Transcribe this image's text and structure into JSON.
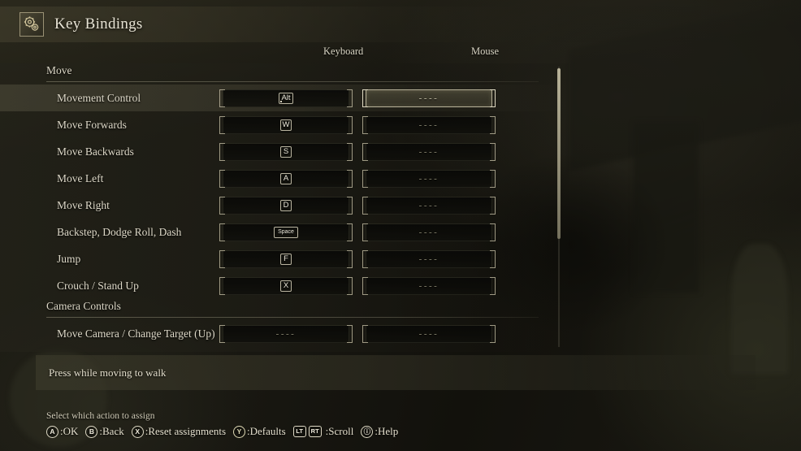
{
  "titlebar": {
    "icon": "gears-icon",
    "title": "Key Bindings"
  },
  "columns": {
    "keyboard": "Keyboard",
    "mouse": "Mouse"
  },
  "sections": [
    {
      "label": "Move",
      "rows": [
        {
          "label": "Movement Control",
          "keyboard": "Alt",
          "keyboard_type": "keycap",
          "keyboard_dotted": true,
          "mouse": "----",
          "selected": true,
          "selected_col": "mouse"
        },
        {
          "label": "Move Forwards",
          "keyboard": "W",
          "keyboard_type": "keycap",
          "keyboard_dotted": false,
          "mouse": "----",
          "selected": false,
          "selected_col": ""
        },
        {
          "label": "Move Backwards",
          "keyboard": "S",
          "keyboard_type": "keycap",
          "keyboard_dotted": false,
          "mouse": "----",
          "selected": false,
          "selected_col": ""
        },
        {
          "label": "Move Left",
          "keyboard": "A",
          "keyboard_type": "keycap",
          "keyboard_dotted": false,
          "mouse": "----",
          "selected": false,
          "selected_col": ""
        },
        {
          "label": "Move Right",
          "keyboard": "D",
          "keyboard_type": "keycap",
          "keyboard_dotted": false,
          "mouse": "----",
          "selected": false,
          "selected_col": ""
        },
        {
          "label": "Backstep, Dodge Roll, Dash",
          "keyboard": "Space",
          "keyboard_type": "keycap-wide",
          "keyboard_dotted": false,
          "mouse": "----",
          "selected": false,
          "selected_col": ""
        },
        {
          "label": "Jump",
          "keyboard": "F",
          "keyboard_type": "keycap",
          "keyboard_dotted": false,
          "mouse": "----",
          "selected": false,
          "selected_col": ""
        },
        {
          "label": "Crouch / Stand Up",
          "keyboard": "X",
          "keyboard_type": "keycap",
          "keyboard_dotted": false,
          "mouse": "----",
          "selected": false,
          "selected_col": ""
        }
      ]
    },
    {
      "label": "Camera Controls",
      "rows": [
        {
          "label": "Move Camera / Change Target (Up)",
          "keyboard": "----",
          "keyboard_type": "text",
          "keyboard_dotted": false,
          "mouse": "----",
          "selected": false,
          "selected_col": ""
        }
      ]
    }
  ],
  "description": {
    "text": "Press while moving to walk"
  },
  "footer": {
    "prompt": "Select which action to assign",
    "hints": [
      {
        "glyph": "A",
        "shape": "circle",
        "label": ":OK"
      },
      {
        "glyph": "B",
        "shape": "circle",
        "label": ":Back"
      },
      {
        "glyph": "X",
        "shape": "circle",
        "label": ":Reset assignments"
      },
      {
        "glyph": "Y",
        "shape": "circle-y",
        "label": ":Defaults"
      },
      {
        "glyph": "LT",
        "shape": "square",
        "glyph2": "RT",
        "label": ":Scroll"
      },
      {
        "glyph": "ⓘ",
        "shape": "circle",
        "label": ":Help"
      }
    ]
  },
  "colors": {
    "accent": "#d6d0b4",
    "panel": "#241f17",
    "text": "#e2ddcb",
    "muted": "#8e8a74"
  }
}
